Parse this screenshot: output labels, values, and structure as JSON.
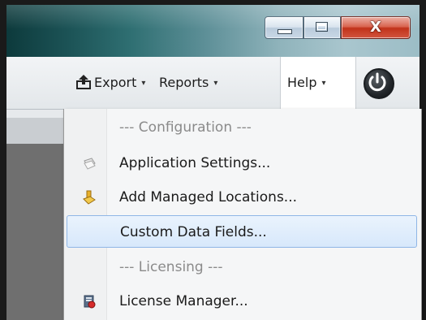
{
  "window_controls": {
    "minimize": "minimize",
    "maximize": "maximize",
    "close_glyph": "X"
  },
  "toolbar": {
    "export_icon": "export-icon",
    "export_label": "Export",
    "reports_label": "Reports",
    "help_label": "Help",
    "dropdown_caret": "▾",
    "power_icon": "power-icon"
  },
  "help_menu": {
    "items": [
      {
        "type": "header",
        "label": "--- Configuration ---"
      },
      {
        "type": "item",
        "label": "Application Settings...",
        "icon": "settings-icon"
      },
      {
        "type": "item",
        "label": "Add Managed Locations...",
        "icon": "folder-icon"
      },
      {
        "type": "item",
        "label": "Custom Data Fields...",
        "selected": true
      },
      {
        "type": "header",
        "label": "--- Licensing ---"
      },
      {
        "type": "item",
        "label": "License Manager...",
        "icon": "license-icon"
      }
    ]
  },
  "colors": {
    "selection_fill": "#d7e8fb",
    "selection_border": "#8fb6e6",
    "close_button": "#c1321a"
  }
}
